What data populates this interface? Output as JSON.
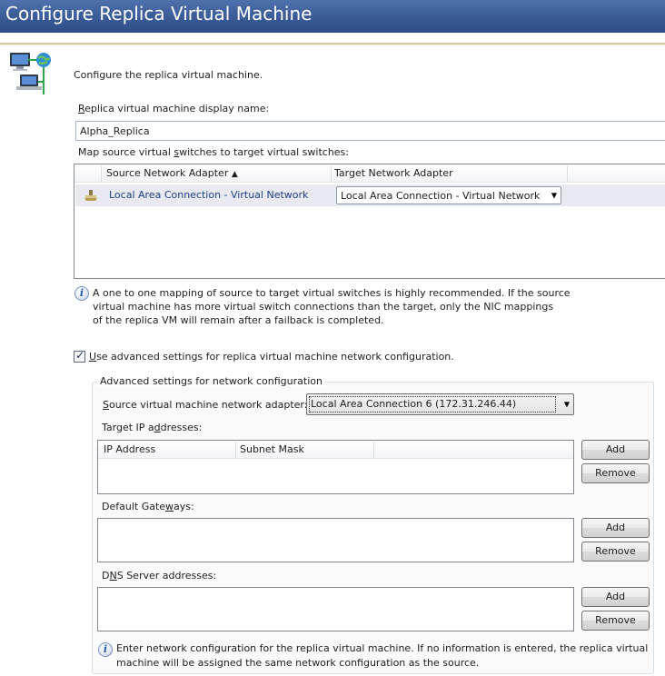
{
  "window": {
    "title": "Configure Replica Virtual Machine"
  },
  "intro": {
    "text": "Configure the replica virtual machine."
  },
  "display_name": {
    "label_accel": "R",
    "label_rest": "eplica virtual machine display name:",
    "value": "Alpha_Replica"
  },
  "map": {
    "label_pre": "Map source virtual ",
    "label_accel": "s",
    "label_post": "witches to target virtual switches:",
    "columns": {
      "source": "Source Network Adapter",
      "target": "Target Network Adapter"
    },
    "sort_indicator": "▲",
    "rows": [
      {
        "source": "Local Area Connection - Virtual Network",
        "target": "Local Area Connection - Virtual Network"
      }
    ]
  },
  "info1": {
    "line1": "A one to one mapping of source to target virtual switches is highly recommended. If the source",
    "line2": "virtual machine has more virtual switch connections than the target, only the NIC mappings",
    "line3": "of the replica VM will remain after a failback is completed."
  },
  "advanced_checkbox": {
    "checked": true,
    "label_accel": "U",
    "label_rest": "se advanced settings for replica virtual machine network configuration."
  },
  "advanced": {
    "group_title": "Advanced settings for network configuration",
    "source_adapter": {
      "label_accel": "S",
      "label_rest": "ource virtual machine network adapter:",
      "selected": "Local Area Connection 6 (172.31.246.44)"
    },
    "target_ip": {
      "label_pre": "Target IP a",
      "label_accel": "d",
      "label_post": "dresses:",
      "columns": {
        "ip": "IP Address",
        "mask": "Subnet Mask"
      },
      "add": "Add",
      "remove": "Remove"
    },
    "gateways": {
      "label_pre": "Default Gate",
      "label_accel": "w",
      "label_post": "ays:",
      "add": "Add",
      "remove": "Remove"
    },
    "dns": {
      "label_pre": "D",
      "label_accel": "N",
      "label_post": "S Server addresses:",
      "add": "Add",
      "remove": "Remove"
    },
    "info": {
      "line1": "Enter network configuration for the replica virtual machine. If no information is entered, the replica virtual",
      "line2": "machine will be assigned the same network configuration as the source."
    }
  }
}
